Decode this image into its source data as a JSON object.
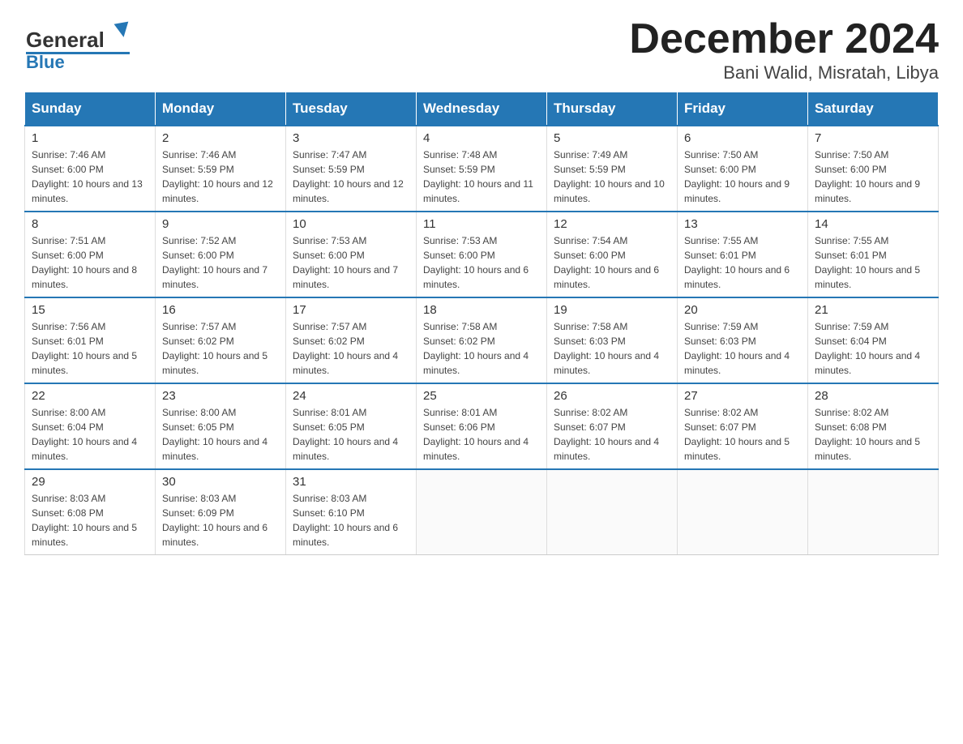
{
  "header": {
    "logo_text_general": "General",
    "logo_text_blue": "Blue",
    "title": "December 2024",
    "subtitle": "Bani Walid, Misratah, Libya"
  },
  "days_of_week": [
    "Sunday",
    "Monday",
    "Tuesday",
    "Wednesday",
    "Thursday",
    "Friday",
    "Saturday"
  ],
  "weeks": [
    [
      {
        "day": "1",
        "sunrise": "7:46 AM",
        "sunset": "6:00 PM",
        "daylight": "10 hours and 13 minutes."
      },
      {
        "day": "2",
        "sunrise": "7:46 AM",
        "sunset": "5:59 PM",
        "daylight": "10 hours and 12 minutes."
      },
      {
        "day": "3",
        "sunrise": "7:47 AM",
        "sunset": "5:59 PM",
        "daylight": "10 hours and 12 minutes."
      },
      {
        "day": "4",
        "sunrise": "7:48 AM",
        "sunset": "5:59 PM",
        "daylight": "10 hours and 11 minutes."
      },
      {
        "day": "5",
        "sunrise": "7:49 AM",
        "sunset": "5:59 PM",
        "daylight": "10 hours and 10 minutes."
      },
      {
        "day": "6",
        "sunrise": "7:50 AM",
        "sunset": "6:00 PM",
        "daylight": "10 hours and 9 minutes."
      },
      {
        "day": "7",
        "sunrise": "7:50 AM",
        "sunset": "6:00 PM",
        "daylight": "10 hours and 9 minutes."
      }
    ],
    [
      {
        "day": "8",
        "sunrise": "7:51 AM",
        "sunset": "6:00 PM",
        "daylight": "10 hours and 8 minutes."
      },
      {
        "day": "9",
        "sunrise": "7:52 AM",
        "sunset": "6:00 PM",
        "daylight": "10 hours and 7 minutes."
      },
      {
        "day": "10",
        "sunrise": "7:53 AM",
        "sunset": "6:00 PM",
        "daylight": "10 hours and 7 minutes."
      },
      {
        "day": "11",
        "sunrise": "7:53 AM",
        "sunset": "6:00 PM",
        "daylight": "10 hours and 6 minutes."
      },
      {
        "day": "12",
        "sunrise": "7:54 AM",
        "sunset": "6:00 PM",
        "daylight": "10 hours and 6 minutes."
      },
      {
        "day": "13",
        "sunrise": "7:55 AM",
        "sunset": "6:01 PM",
        "daylight": "10 hours and 6 minutes."
      },
      {
        "day": "14",
        "sunrise": "7:55 AM",
        "sunset": "6:01 PM",
        "daylight": "10 hours and 5 minutes."
      }
    ],
    [
      {
        "day": "15",
        "sunrise": "7:56 AM",
        "sunset": "6:01 PM",
        "daylight": "10 hours and 5 minutes."
      },
      {
        "day": "16",
        "sunrise": "7:57 AM",
        "sunset": "6:02 PM",
        "daylight": "10 hours and 5 minutes."
      },
      {
        "day": "17",
        "sunrise": "7:57 AM",
        "sunset": "6:02 PM",
        "daylight": "10 hours and 4 minutes."
      },
      {
        "day": "18",
        "sunrise": "7:58 AM",
        "sunset": "6:02 PM",
        "daylight": "10 hours and 4 minutes."
      },
      {
        "day": "19",
        "sunrise": "7:58 AM",
        "sunset": "6:03 PM",
        "daylight": "10 hours and 4 minutes."
      },
      {
        "day": "20",
        "sunrise": "7:59 AM",
        "sunset": "6:03 PM",
        "daylight": "10 hours and 4 minutes."
      },
      {
        "day": "21",
        "sunrise": "7:59 AM",
        "sunset": "6:04 PM",
        "daylight": "10 hours and 4 minutes."
      }
    ],
    [
      {
        "day": "22",
        "sunrise": "8:00 AM",
        "sunset": "6:04 PM",
        "daylight": "10 hours and 4 minutes."
      },
      {
        "day": "23",
        "sunrise": "8:00 AM",
        "sunset": "6:05 PM",
        "daylight": "10 hours and 4 minutes."
      },
      {
        "day": "24",
        "sunrise": "8:01 AM",
        "sunset": "6:05 PM",
        "daylight": "10 hours and 4 minutes."
      },
      {
        "day": "25",
        "sunrise": "8:01 AM",
        "sunset": "6:06 PM",
        "daylight": "10 hours and 4 minutes."
      },
      {
        "day": "26",
        "sunrise": "8:02 AM",
        "sunset": "6:07 PM",
        "daylight": "10 hours and 4 minutes."
      },
      {
        "day": "27",
        "sunrise": "8:02 AM",
        "sunset": "6:07 PM",
        "daylight": "10 hours and 5 minutes."
      },
      {
        "day": "28",
        "sunrise": "8:02 AM",
        "sunset": "6:08 PM",
        "daylight": "10 hours and 5 minutes."
      }
    ],
    [
      {
        "day": "29",
        "sunrise": "8:03 AM",
        "sunset": "6:08 PM",
        "daylight": "10 hours and 5 minutes."
      },
      {
        "day": "30",
        "sunrise": "8:03 AM",
        "sunset": "6:09 PM",
        "daylight": "10 hours and 6 minutes."
      },
      {
        "day": "31",
        "sunrise": "8:03 AM",
        "sunset": "6:10 PM",
        "daylight": "10 hours and 6 minutes."
      },
      null,
      null,
      null,
      null
    ]
  ],
  "labels": {
    "sunrise": "Sunrise:",
    "sunset": "Sunset:",
    "daylight": "Daylight:"
  }
}
